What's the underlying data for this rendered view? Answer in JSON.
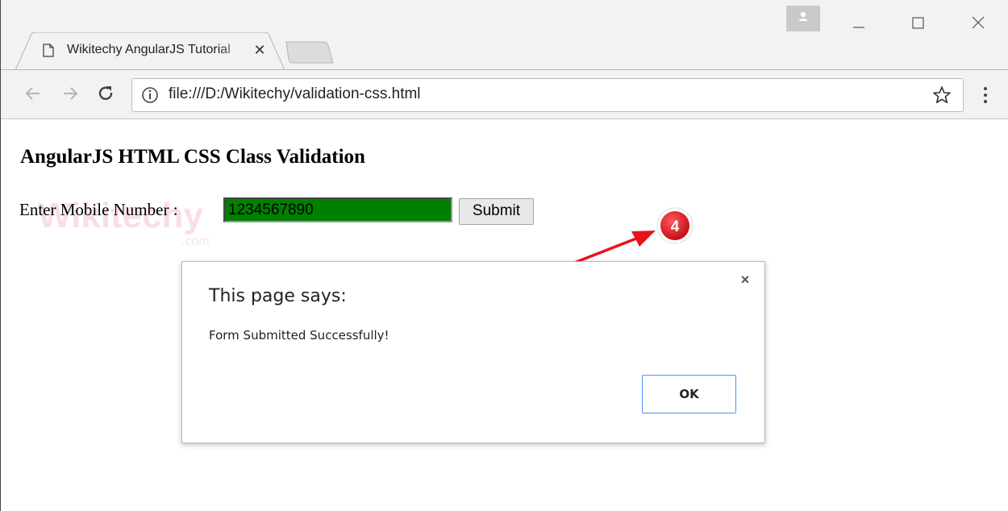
{
  "browser": {
    "tab_title": "Wikitechy AngularJS Tutorial",
    "tab_close_glyph": "✕",
    "url": "file:///D:/Wikitechy/validation-css.html",
    "icons": [
      "page-icon",
      "back-icon",
      "forward-icon",
      "reload-icon",
      "info-icon",
      "star-icon",
      "menu-icon",
      "profile-icon",
      "minimize-icon",
      "maximize-icon",
      "close-icon"
    ]
  },
  "page": {
    "heading": "AngularJS HTML CSS Class Validation",
    "field_label": "Enter Mobile Number :",
    "mobile_value": "1234567890",
    "input_color": "#008000",
    "submit_label": "Submit",
    "watermark": "Wikitechy",
    "watermark_sub": ".com"
  },
  "annotation": {
    "step_number": "4",
    "badge_color": "#e8141c",
    "arrow_color": "#e8141c"
  },
  "dialog": {
    "title": "This page says:",
    "message": "Form Submitted Successfully!",
    "close_glyph": "×",
    "ok_label": "OK"
  }
}
